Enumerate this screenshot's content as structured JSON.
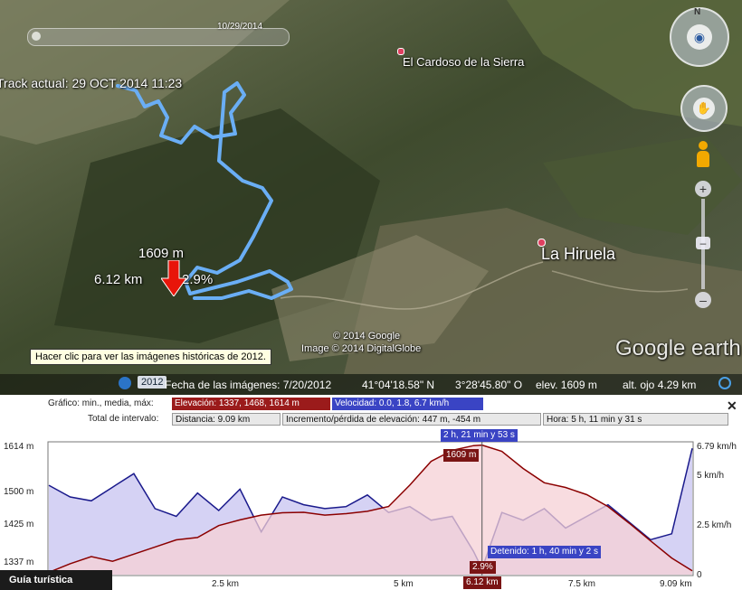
{
  "map": {
    "time_slider_date": "10/29/2014",
    "track_label": "Track actual: 29 OCT 2014 11:23",
    "places": {
      "el_cardoso": "El Cardoso de la Sierra",
      "la_hiruela": "La Hiruela"
    },
    "marker": {
      "elevation": "1609 m",
      "distance": "6.12 km",
      "slope": "2.9%"
    },
    "copyright_google": "© 2014 Google",
    "copyright_image": "Image © 2014 DigitalGlobe",
    "brand": "Google earth",
    "tooltip": "Hacer clic para ver las imágenes históricas de 2012.",
    "status": {
      "year_badge": "2012",
      "imagery_date": "Fecha de las imágenes: 7/20/2012",
      "lat": "41°04'18.58\" N",
      "lon": "3°28'45.80\" O",
      "elev": "elev.  1609 m",
      "eye_alt": "alt. ojo   4.29 km"
    },
    "colors": {
      "track": "#6aaef5",
      "marker": "#e8150a"
    }
  },
  "profile": {
    "row1_label": "Gráfico: min., media, máx:",
    "elevation_box": "Elevación: 1337, 1468, 1614 m",
    "speed_box": "Velocidad: 0.0, 1.8, 6.7 km/h",
    "row2_label": "Total de intervalo:",
    "distance_box": "Distancia: 9.09 km",
    "gain_box": "Incremento/pérdida de elevación: 447 m, -454 m",
    "time_box": "Hora: 5 h, 11 min y 31 s",
    "cursor_time": "2 h, 21 min y 53 s",
    "cursor_elev": "1609 m",
    "cursor_slope": "2.9%",
    "cursor_dist": "6.12 km",
    "stopped": "Detenido: 1 h, 40 min y 2 s",
    "left_ticks": [
      "1614 m",
      "1500 m",
      "1425 m",
      "1337 m"
    ],
    "right_ticks": [
      "6.79 km/h",
      "5 km/h",
      "2.5 km/h",
      "0"
    ],
    "x_ticks": [
      "2.5 km",
      "5 km",
      "7.5 km",
      "9.09 km"
    ],
    "guide": "Guía turística",
    "colors": {
      "elevation_line": "#8b0000",
      "elevation_fill": "#f5d0d6",
      "speed_line": "#1a1a8c",
      "speed_fill": "#c7c3f0"
    }
  },
  "chart_data": {
    "type": "area",
    "x_unit": "km",
    "xlim": [
      0,
      9.09
    ],
    "series": [
      {
        "name": "Elevación",
        "axis": "left",
        "ylim": [
          1337,
          1614
        ],
        "x": [
          0,
          0.3,
          0.6,
          0.9,
          1.2,
          1.5,
          1.8,
          2.1,
          2.4,
          2.7,
          3.0,
          3.3,
          3.6,
          3.9,
          4.2,
          4.5,
          4.8,
          5.1,
          5.4,
          5.7,
          6.0,
          6.12,
          6.4,
          6.7,
          7.0,
          7.3,
          7.6,
          7.9,
          8.2,
          8.5,
          8.8,
          9.09
        ],
        "values": [
          1342,
          1360,
          1375,
          1365,
          1380,
          1395,
          1410,
          1415,
          1440,
          1452,
          1462,
          1467,
          1468,
          1462,
          1465,
          1470,
          1480,
          1525,
          1575,
          1598,
          1608,
          1609,
          1596,
          1560,
          1530,
          1520,
          1505,
          1480,
          1445,
          1408,
          1372,
          1345
        ]
      },
      {
        "name": "Velocidad",
        "axis": "right",
        "ylim": [
          0,
          6.79
        ],
        "x": [
          0,
          0.3,
          0.6,
          0.9,
          1.2,
          1.5,
          1.8,
          2.1,
          2.4,
          2.7,
          3.0,
          3.3,
          3.6,
          3.9,
          4.2,
          4.5,
          4.8,
          5.1,
          5.4,
          5.7,
          6.0,
          6.12,
          6.4,
          6.7,
          7.0,
          7.3,
          7.6,
          7.9,
          8.2,
          8.5,
          8.8,
          9.09
        ],
        "values": [
          4.6,
          4.0,
          3.8,
          4.5,
          5.2,
          3.4,
          3.0,
          4.2,
          3.3,
          4.4,
          2.2,
          4.0,
          3.6,
          3.4,
          3.5,
          4.1,
          3.2,
          3.5,
          2.8,
          3.0,
          1.2,
          0.3,
          3.2,
          2.8,
          3.4,
          2.4,
          3.0,
          3.6,
          2.7,
          1.8,
          2.1,
          6.5
        ]
      }
    ]
  }
}
